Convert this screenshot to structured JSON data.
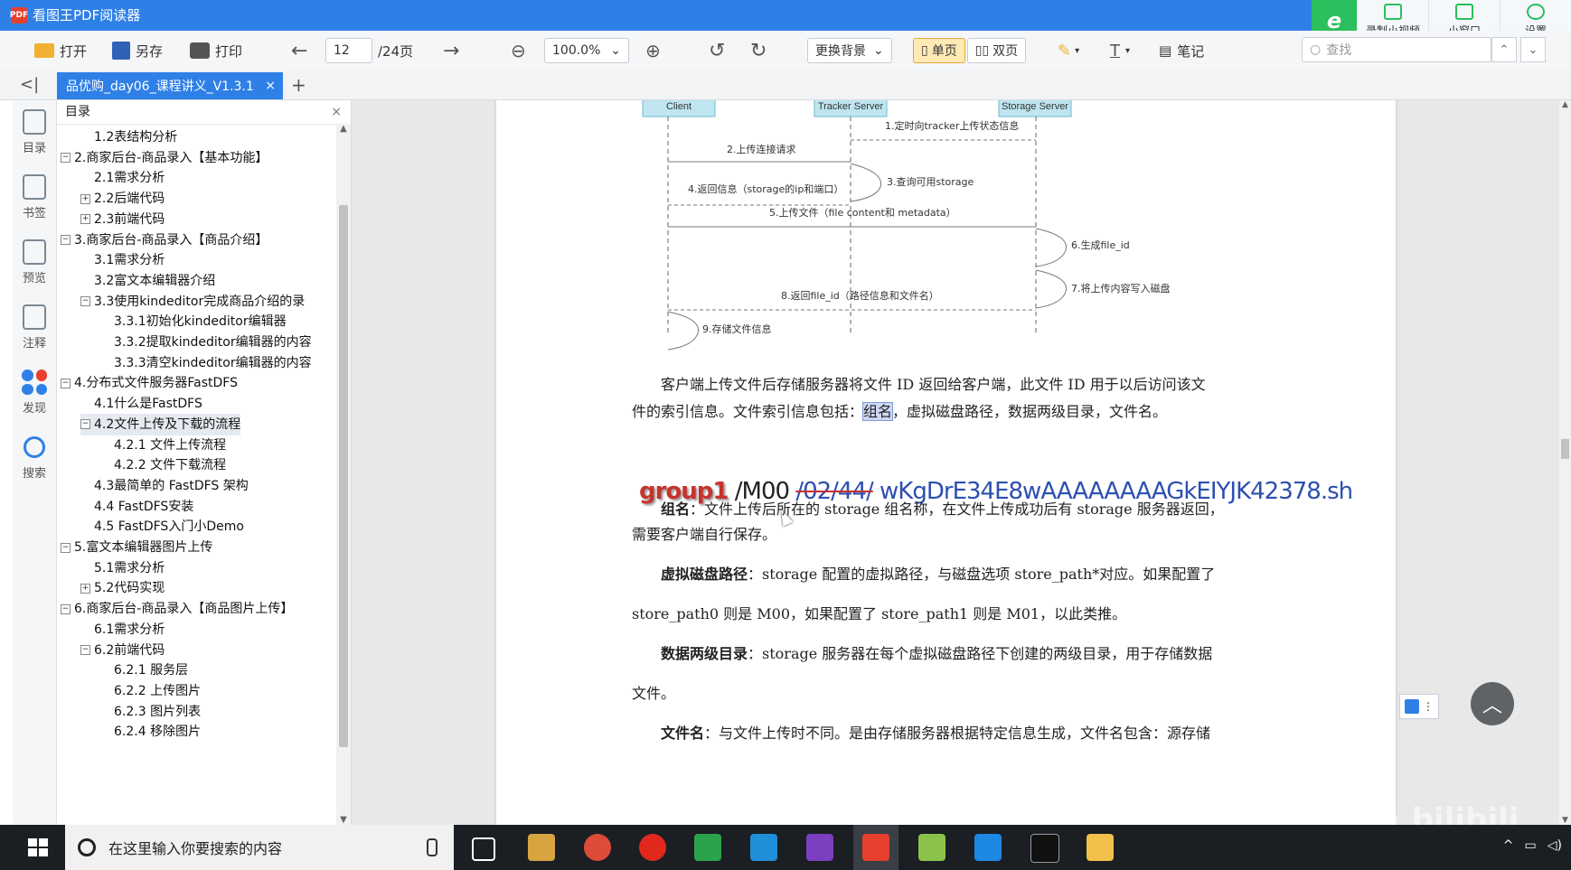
{
  "app": {
    "title": "看图王PDF阅读器",
    "badge": "PDF",
    "right_buttons": [
      "录制小视频",
      "小窗口",
      "设置"
    ]
  },
  "toolbar": {
    "open": "打开",
    "saveas": "另存",
    "print": "打印",
    "page_current": "12",
    "page_total": "/24页",
    "zoom": "100.0%",
    "background": "更换背景",
    "single_page": "单页",
    "double_page": "双页",
    "notes": "笔记",
    "search_placeholder": "查找"
  },
  "tab": {
    "label": "品优购_day06_课程讲义_V1.3.1",
    "close": "×",
    "add": "+"
  },
  "leftbar": [
    "目录",
    "书签",
    "预览",
    "注释",
    "发现",
    "搜索"
  ],
  "toc": {
    "title": "目录",
    "items": [
      {
        "label": "1.2表结构分析",
        "level": 2,
        "pm": ""
      },
      {
        "label": "2.商家后台-商品录入【基本功能】",
        "level": 1,
        "pm": "-"
      },
      {
        "label": "2.1需求分析",
        "level": 2,
        "pm": ""
      },
      {
        "label": "2.2后端代码",
        "level": 2,
        "pm": "+"
      },
      {
        "label": "2.3前端代码",
        "level": 2,
        "pm": "+"
      },
      {
        "label": "3.商家后台-商品录入【商品介绍】",
        "level": 1,
        "pm": "-"
      },
      {
        "label": "3.1需求分析",
        "level": 2,
        "pm": ""
      },
      {
        "label": "3.2富文本编辑器介绍",
        "level": 2,
        "pm": ""
      },
      {
        "label": "3.3使用kindeditor完成商品介绍的录",
        "level": 2,
        "pm": "-"
      },
      {
        "label": "3.3.1初始化kindeditor编辑器",
        "level": 3,
        "pm": ""
      },
      {
        "label": "3.3.2提取kindeditor编辑器的内容",
        "level": 3,
        "pm": ""
      },
      {
        "label": "3.3.3清空kindeditor编辑器的内容",
        "level": 3,
        "pm": ""
      },
      {
        "label": "4.分布式文件服务器FastDFS",
        "level": 1,
        "pm": "-"
      },
      {
        "label": "4.1什么是FastDFS",
        "level": 2,
        "pm": ""
      },
      {
        "label": "4.2文件上传及下载的流程",
        "level": 2,
        "pm": "-"
      },
      {
        "label": "4.2.1 文件上传流程",
        "level": 3,
        "pm": ""
      },
      {
        "label": "4.2.2 文件下载流程",
        "level": 3,
        "pm": ""
      },
      {
        "label": "4.3最简单的 FastDFS 架构",
        "level": 2,
        "pm": ""
      },
      {
        "label": "4.4 FastDFS安装",
        "level": 2,
        "pm": ""
      },
      {
        "label": "4.5 FastDFS入门小Demo",
        "level": 2,
        "pm": ""
      },
      {
        "label": "5.富文本编辑器图片上传",
        "level": 1,
        "pm": "-"
      },
      {
        "label": "5.1需求分析",
        "level": 2,
        "pm": ""
      },
      {
        "label": "5.2代码实现",
        "level": 2,
        "pm": "+"
      },
      {
        "label": "6.商家后台-商品录入【商品图片上传】",
        "level": 1,
        "pm": "-"
      },
      {
        "label": "6.1需求分析",
        "level": 2,
        "pm": ""
      },
      {
        "label": "6.2前端代码",
        "level": 2,
        "pm": "-"
      },
      {
        "label": "6.2.1 服务层",
        "level": 3,
        "pm": ""
      },
      {
        "label": "6.2.2 上传图片",
        "level": 3,
        "pm": ""
      },
      {
        "label": "6.2.3 图片列表",
        "level": 3,
        "pm": ""
      },
      {
        "label": "6.2.4 移除图片",
        "level": 3,
        "pm": ""
      }
    ],
    "selected_index": 14
  },
  "diagram": {
    "lanes": [
      "Client",
      "Tracker Server",
      "Storage Server"
    ],
    "messages": [
      "1.定时向tracker上传状态信息",
      "2.上传连接请求",
      "3.查询可用storage",
      "4.返回信息（storage的ip和端口）",
      "5.上传文件（file content和 metadata）",
      "6.生成file_id",
      "7.将上传内容写入磁盘",
      "8.返回file_id（路径信息和文件名）",
      "9.存储文件信息"
    ]
  },
  "doc": {
    "p1_a": "客户端上传文件后存储服务器将文件 ID 返回给客户端，此文件 ID 用于以后访问该文",
    "p1_b_pre": "件的索引信息。文件索引信息包括：",
    "p1_b_hl": "组名",
    "p1_b_post": "，虚拟磁盘路径，数据两级目录，文件名。",
    "fileid_group": "group1",
    "fileid_m00": " /M00 ",
    "fileid_dirs": "/02/44/",
    "fileid_name": " wKgDrE34E8wAAAAAAAAGkEIYJK42378.sh",
    "p2_label": "组名",
    "p2_text": "：文件上传后所在的 storage 组名称，在文件上传成功后有 storage 服务器返回，",
    "p2_b": "需要客户端自行保存。",
    "p3_label": "虚拟磁盘路径",
    "p3_text": "：storage 配置的虚拟路径，与磁盘选项 store_path*对应。如果配置了",
    "p3_b": "store_path0 则是 M00，如果配置了 store_path1 则是 M01，以此类推。",
    "p4_label": "数据两级目录",
    "p4_text": "：storage 服务器在每个虚拟磁盘路径下创建的两级目录，用于存储数据",
    "p4_b": "文件。",
    "p5_label": "文件名",
    "p5_text": "：与文件上传时不同。是由存储服务器根据特定信息生成，文件名包含：源存储"
  },
  "watermark": "黑马程序员 bilibili",
  "taskbar": {
    "search_placeholder": "在这里输入你要搜索的内容"
  },
  "colors": {
    "accent": "#2f80e6",
    "highlight_red": "#c8322c",
    "link_blue": "#2d4fb0"
  }
}
